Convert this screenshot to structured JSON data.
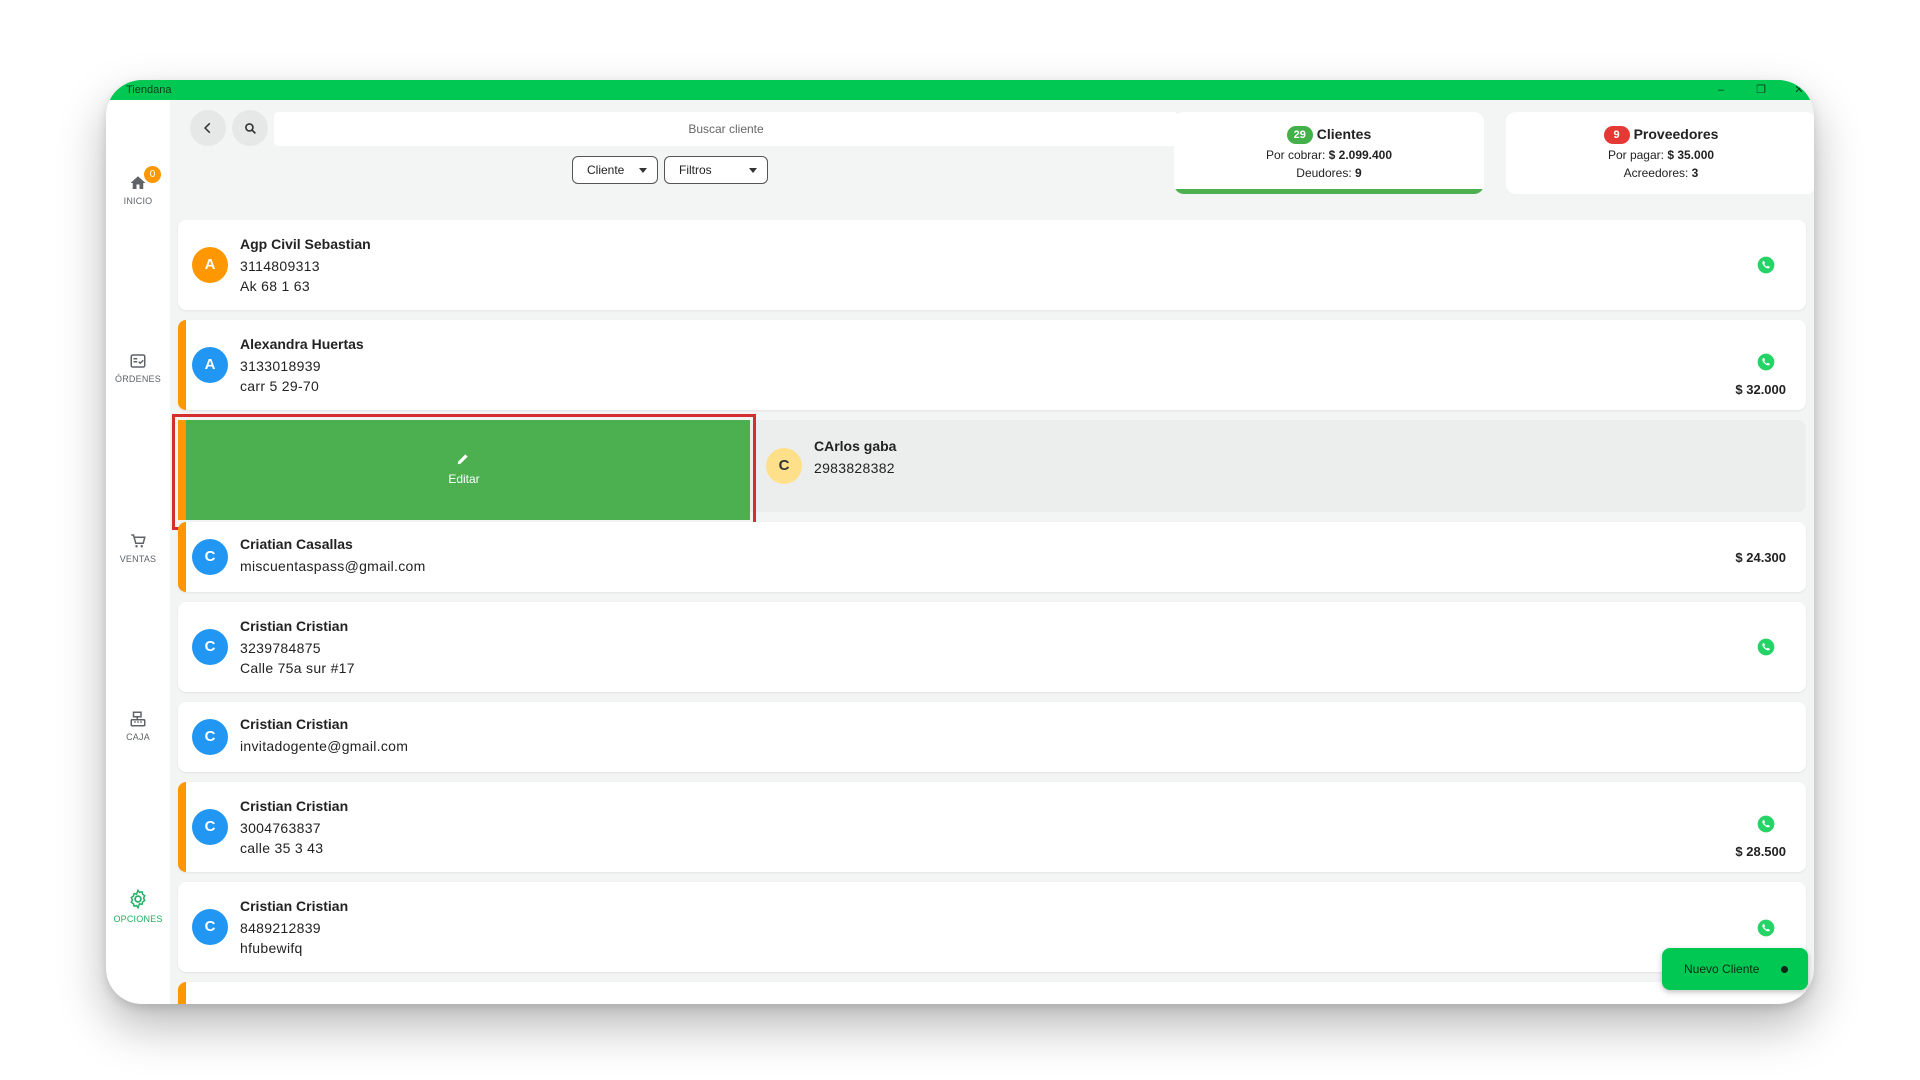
{
  "window": {
    "title": "Tiendana",
    "minimize": "–",
    "maximize": "❐",
    "close": "✕"
  },
  "sidebar": {
    "items": [
      {
        "label": "INICIO",
        "icon": "home-icon",
        "badge": "0"
      },
      {
        "label": "ÓRDENES",
        "icon": "orders-icon"
      },
      {
        "label": "VENTAS",
        "icon": "cart-icon"
      },
      {
        "label": "CAJA",
        "icon": "cash-register-icon"
      },
      {
        "label": "OPCIONES",
        "icon": "gear-icon",
        "active": true
      }
    ]
  },
  "search": {
    "placeholder": "Buscar cliente"
  },
  "filters": {
    "type": "Cliente",
    "filters": "Filtros"
  },
  "summary": {
    "clients": {
      "count": "29",
      "title": "Clientes",
      "receivable_label": "Por cobrar:",
      "receivable_value": "$ 2.099.400",
      "debtors_label": "Deudores:",
      "debtors_value": "9",
      "badge_color": "#43b049"
    },
    "suppliers": {
      "count": "9",
      "title": "Proveedores",
      "payable_label": "Por pagar:",
      "payable_value": "$ 35.000",
      "creditors_label": "Acreedores:",
      "creditors_value": "3",
      "badge_color": "#e53935"
    }
  },
  "clients": [
    {
      "initial": "A",
      "name": "Agp Civil Sebastian",
      "line1": "3114809313",
      "line2": "Ak 68 1 63",
      "amount": "",
      "color": "#ff9800"
    },
    {
      "initial": "A",
      "name": "Alexandra Huertas",
      "line1": "3133018939",
      "line2": "carr 5 29-70",
      "amount": "$ 32.000",
      "color": "#2196f3"
    },
    {
      "initial": "C",
      "name": "CArlos gaba",
      "line1": "2983828382",
      "line2": "",
      "amount": "",
      "color": "#ffe08a"
    },
    {
      "initial": "C",
      "name": "Criatian Casallas",
      "line1": "miscuentaspass@gmail.com",
      "line2": "",
      "amount": "$ 24.300",
      "color": "#2196f3"
    },
    {
      "initial": "C",
      "name": "Cristian Cristian",
      "line1": "3239784875",
      "line2": "Calle 75a sur #17",
      "amount": "",
      "color": "#2196f3"
    },
    {
      "initial": "C",
      "name": "Cristian Cristian",
      "line1": "invitadogente@gmail.com",
      "line2": "",
      "amount": "",
      "color": "#2196f3"
    },
    {
      "initial": "C",
      "name": "Cristian Cristian",
      "line1": "3004763837",
      "line2": "calle 35 3 43",
      "amount": "$ 28.500",
      "color": "#2196f3"
    },
    {
      "initial": "C",
      "name": "Cristian Cristian",
      "line1": "8489212839",
      "line2": "hfubewifq",
      "amount": "",
      "color": "#2196f3"
    }
  ],
  "swipe_action": {
    "label": "Editar",
    "icon": "pencil-icon"
  },
  "fab": {
    "label": "Nuevo Cliente"
  },
  "colors": {
    "brand_green": "#00c853",
    "accent_orange": "#ff9800",
    "action_green": "#4caf50",
    "avatar_blue": "#2196f3",
    "highlight_red": "#d32f2f"
  }
}
